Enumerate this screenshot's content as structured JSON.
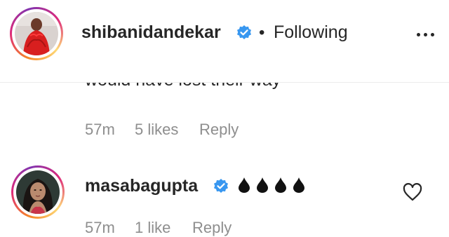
{
  "post_header": {
    "username": "shibanidandekar",
    "separator": "•",
    "follow_state": "Following",
    "avatar_icon": "profile-photo-red-dress",
    "verified_icon": "verified-badge-icon",
    "more_icon": "more-options-icon"
  },
  "comments": [
    {
      "text_tail": "would have lost their way",
      "time": "57m",
      "likes": "5 likes",
      "reply": "Reply"
    },
    {
      "username": "masabagupta",
      "text": "💧💧💧💧",
      "time": "57m",
      "likes": "1 like",
      "reply": "Reply",
      "avatar_icon": "profile-photo-portrait",
      "verified_icon": "verified-badge-icon",
      "like_icon": "heart-outline-icon"
    }
  ],
  "colors": {
    "text": "#262626",
    "secondary_text": "#8e8e8e",
    "verified_blue": "#3897f0",
    "story_ring": [
      "#f58529",
      "#dd2a7b",
      "#8134af",
      "#feda77"
    ]
  }
}
